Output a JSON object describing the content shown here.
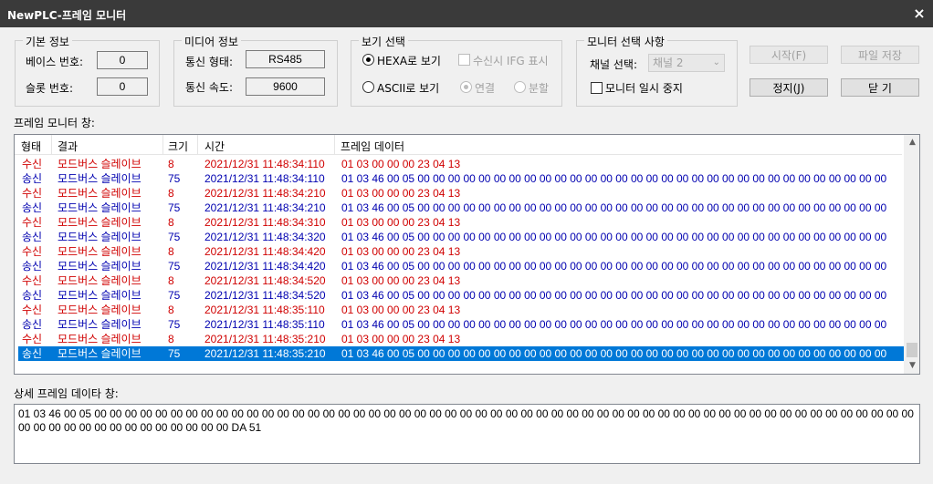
{
  "window": {
    "title": "NewPLC-프레임 모니터",
    "close_glyph": "×"
  },
  "basic_info": {
    "title": "기본 정보",
    "base_label": "베이스 번호:",
    "base_value": "0",
    "slot_label": "슬롯 번호:",
    "slot_value": "0"
  },
  "media_info": {
    "title": "미디어 정보",
    "type_label": "통신 형태:",
    "type_value": "RS485",
    "speed_label": "통신 속도:",
    "speed_value": "9600"
  },
  "view_select": {
    "title": "보기 선택",
    "hexa_label": "HEXA로 보기",
    "ascii_label": "ASCII로 보기",
    "ifg_label": "수신시 IFG 표시",
    "connect_label": "연결",
    "split_label": "분할"
  },
  "monitor_select": {
    "title": "모니터 선택 사항",
    "channel_label": "채널 선택:",
    "channel_value": "채널 2",
    "pause_label": "모니터 일시 중지"
  },
  "buttons": {
    "start": "시작(F)",
    "save_file": "파일 저장",
    "stop": "정지(J)",
    "close": "닫 기"
  },
  "frame_monitor": {
    "title": "프레임 모니터 창:",
    "columns": [
      "형태",
      "결과",
      "크기",
      "시간",
      "프레임 데이터"
    ],
    "rows": [
      {
        "type": "수신",
        "result": "모드버스 슬레이브",
        "size": "8",
        "time": "2021/12/31 11:48:34:110",
        "data": "01 03 00 00 00 23 04 13",
        "kind": "recv"
      },
      {
        "type": "송신",
        "result": "모드버스 슬레이브",
        "size": "75",
        "time": "2021/12/31 11:48:34:110",
        "data": "01 03 46 00 05 00 00 00 00 00 00 00 00 00 00 00 00 00 00 00 00 00 00 00 00 00 00 00 00 00 00 00 00 00 00 00 00 00 00 00 00 00 00 00 ...",
        "kind": "send"
      },
      {
        "type": "수신",
        "result": "모드버스 슬레이브",
        "size": "8",
        "time": "2021/12/31 11:48:34:210",
        "data": "01 03 00 00 00 23 04 13",
        "kind": "recv"
      },
      {
        "type": "송신",
        "result": "모드버스 슬레이브",
        "size": "75",
        "time": "2021/12/31 11:48:34:210",
        "data": "01 03 46 00 05 00 00 00 00 00 00 00 00 00 00 00 00 00 00 00 00 00 00 00 00 00 00 00 00 00 00 00 00 00 00 00 00 00 00 00 00 00 00 00 ...",
        "kind": "send"
      },
      {
        "type": "수신",
        "result": "모드버스 슬레이브",
        "size": "8",
        "time": "2021/12/31 11:48:34:310",
        "data": "01 03 00 00 00 23 04 13",
        "kind": "recv"
      },
      {
        "type": "송신",
        "result": "모드버스 슬레이브",
        "size": "75",
        "time": "2021/12/31 11:48:34:320",
        "data": "01 03 46 00 05 00 00 00 00 00 00 00 00 00 00 00 00 00 00 00 00 00 00 00 00 00 00 00 00 00 00 00 00 00 00 00 00 00 00 00 00 00 00 00 ...",
        "kind": "send"
      },
      {
        "type": "수신",
        "result": "모드버스 슬레이브",
        "size": "8",
        "time": "2021/12/31 11:48:34:420",
        "data": "01 03 00 00 00 23 04 13",
        "kind": "recv"
      },
      {
        "type": "송신",
        "result": "모드버스 슬레이브",
        "size": "75",
        "time": "2021/12/31 11:48:34:420",
        "data": "01 03 46 00 05 00 00 00 00 00 00 00 00 00 00 00 00 00 00 00 00 00 00 00 00 00 00 00 00 00 00 00 00 00 00 00 00 00 00 00 00 00 00 00 ...",
        "kind": "send"
      },
      {
        "type": "수신",
        "result": "모드버스 슬레이브",
        "size": "8",
        "time": "2021/12/31 11:48:34:520",
        "data": "01 03 00 00 00 23 04 13",
        "kind": "recv"
      },
      {
        "type": "송신",
        "result": "모드버스 슬레이브",
        "size": "75",
        "time": "2021/12/31 11:48:34:520",
        "data": "01 03 46 00 05 00 00 00 00 00 00 00 00 00 00 00 00 00 00 00 00 00 00 00 00 00 00 00 00 00 00 00 00 00 00 00 00 00 00 00 00 00 00 00 ...",
        "kind": "send"
      },
      {
        "type": "수신",
        "result": "모드버스 슬레이브",
        "size": "8",
        "time": "2021/12/31 11:48:35:110",
        "data": "01 03 00 00 00 23 04 13",
        "kind": "recv"
      },
      {
        "type": "송신",
        "result": "모드버스 슬레이브",
        "size": "75",
        "time": "2021/12/31 11:48:35:110",
        "data": "01 03 46 00 05 00 00 00 00 00 00 00 00 00 00 00 00 00 00 00 00 00 00 00 00 00 00 00 00 00 00 00 00 00 00 00 00 00 00 00 00 00 00 00 ...",
        "kind": "send"
      },
      {
        "type": "수신",
        "result": "모드버스 슬레이브",
        "size": "8",
        "time": "2021/12/31 11:48:35:210",
        "data": "01 03 00 00 00 23 04 13",
        "kind": "recv"
      },
      {
        "type": "송신",
        "result": "모드버스 슬레이브",
        "size": "75",
        "time": "2021/12/31 11:48:35:210",
        "data": "01 03 46 00 05 00 00 00 00 00 00 00 00 00 00 00 00 00 00 00 00 00 00 00 00 00 00 00 00 00 00 00 00 00 00 00 00 00 00 00 00 00 00 00 ...",
        "kind": "send",
        "selected": true
      }
    ],
    "scroll_up_glyph": "▲",
    "scroll_down_glyph": "▼"
  },
  "detail": {
    "title": "상세 프레임 데이타 창:",
    "text": "01 03 46 00 05 00 00 00 00 00 00 00 00 00 00 00 00 00 00 00 00 00 00 00 00 00 00 00 00 00 00 00 00 00 00 00 00 00 00 00 00 00 00 00 00 00 00 00 00 00 00 00 00 00 00 00 00 00 00 00 00 00 00 00 00 00 00 00 00 00 00 00 00 DA 51"
  },
  "colors": {
    "recv": "#d00000",
    "send": "#0000b0",
    "selected": "#0078d7",
    "titlebar": "#3a3a3a"
  }
}
